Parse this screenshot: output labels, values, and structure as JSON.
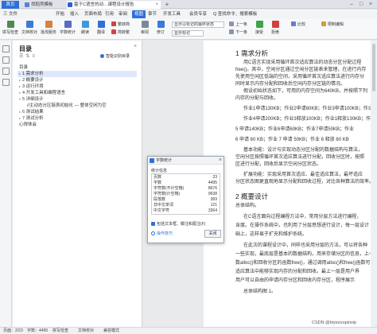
{
  "tabs": {
    "home": "首页",
    "doc": "找稻壳模板",
    "active": "基于C语言的动…课程设计报告"
  },
  "menu": [
    "三 文件",
    "开始",
    "插入",
    "页面布局",
    "引用",
    "审阅",
    "视图",
    "章节",
    "开发工具",
    "会员专享"
  ],
  "menu_active_index": 6,
  "menu_search": "Q 查找命令、搜索模板",
  "ribbon": {
    "buttons": [
      "拼写检查",
      "文档校对",
      "批改服务",
      "字数统计",
      "朗读",
      "翻译",
      "繁转简",
      "简转繁"
    ],
    "combo": "显示以标记的最终状态",
    "combo2": "显示标记",
    "right_items": [
      "审阅",
      "修订",
      "上一条",
      "下一条",
      "接受",
      "拒绝",
      "比较",
      "限制编辑"
    ]
  },
  "toc": {
    "title": "目录",
    "ai_label": "智能识别目录",
    "items": [
      {
        "label": "目录",
        "level": 1
      },
      {
        "label": "1 需求分析",
        "level": 1,
        "selected": true
      },
      {
        "label": "2 概要设计",
        "level": 1
      },
      {
        "label": "3 运行环境",
        "level": 1
      },
      {
        "label": "4 开发工具和编程语言",
        "level": 1
      },
      {
        "label": "5 详细设计",
        "level": 1
      },
      {
        "label": "//主动态分区链表初始化 — 整体空闲为空",
        "level": 2
      },
      {
        "label": "6 测试结果",
        "level": 1
      },
      {
        "label": "7 测试分析",
        "level": 1
      },
      {
        "label": "心得体会",
        "level": 1
      }
    ]
  },
  "doc": {
    "h1": "1 需求分析",
    "lines1": [
      "用C语言实现采用循环首次适应算法的动态分区分配过程",
      "free()。其中，空闲分区通过空闲分区链表来管理，在进行内存",
      "先使用空闲区低端的空间，采用循环首次适应算法进行内存分",
      "同时显示内存分配和回收后空闲内存分区链的情况。",
      "假设初始状态如下，可用的内存空间为640KB，并按照下列",
      "内存的分配与回收。",
      "作业1申请130KB；作业2申请60KB；作业3申请100KB；作业",
      "作业4申请200KB；作业3释放100KB；作业1释放130KB；作",
      "5 申请140KB；作业6申请60KB；作业7申请50KB；作业",
      "6 申请 60 KB；作业 7 申请 50KB；作业 6 释放 60 KB",
      "基本功能：设计与实现动态分区分配的数据结构与算法，",
      "空闲分区按照循环首次适应算法进行分配，回收分区时，按照",
      "区进行分配，回收后显示空闲分区状态。",
      "扩展功能：实现采用首次适应、最佳适应算法，最坏适应",
      "分区状态图更直观地显示分配和回收过程，对比各种算法的效率。"
    ],
    "h2": "2 概要设计",
    "lines2": [
      "总体结构。",
      "在C语言面向过程编程方法中，常用分层方法进行编程，",
      "含度。在操作系统中，也利用了分层思想进行设计，每一层设计",
      "础上，这样易于扩充和维护系统。",
      "在此次的课程设计中，同样也采用分层的方法，可以将各种",
      "一些实现，最底层是基本的数据结构，用来存储分区的信息，上一",
      "数alloc()和回收分区的函数free()，通过调用alloc()和free()函数可",
      "适应算法中能够实现内存的分配和回收。最上一层是用户界",
      "用户可以自由的申请内存分区和回收内存分区，程序展示",
      "总体结构图 1。"
    ]
  },
  "dialog": {
    "title": "字数统计",
    "section": "统计信息",
    "rows": [
      {
        "k": "页数",
        "v": "23"
      },
      {
        "k": "字数",
        "v": "4495"
      },
      {
        "k": "字符数(不计空格)",
        "v": "8676"
      },
      {
        "k": "字符数(计空格)",
        "v": "9638"
      },
      {
        "k": "段落数",
        "v": "369"
      },
      {
        "k": "非中文单词",
        "v": "121"
      },
      {
        "k": "中文字符",
        "v": "3364"
      }
    ],
    "checkbox": "包括文本框、脚注和尾注(F)",
    "link": "操作技巧",
    "close_btn": "关闭"
  },
  "status": {
    "page": "页面：2/23",
    "words": "字数：4495",
    "spell": "拼写检查",
    "proof": "文档校对",
    "mode": "兼容模式"
  },
  "watermark": "CSDN @biyezuopinvip"
}
